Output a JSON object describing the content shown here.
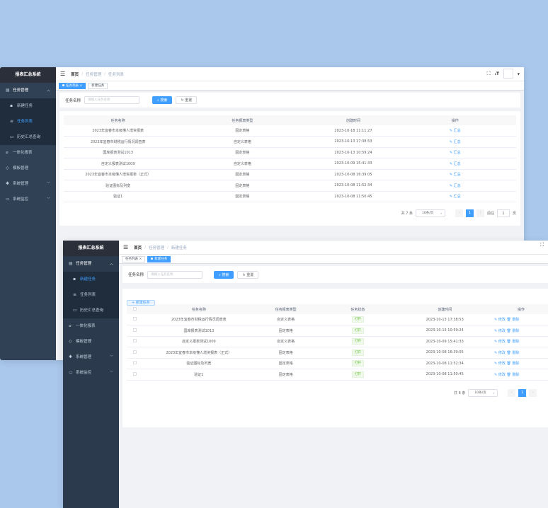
{
  "win1": {
    "app_title": "报表汇总系统",
    "menu": [
      {
        "label": "任务管理",
        "chevron": "^"
      },
      {
        "label": "新建任务"
      },
      {
        "label": "任务列表"
      },
      {
        "label": "历史汇总查询"
      },
      {
        "label": "一体化报表"
      },
      {
        "label": "模板管理"
      },
      {
        "label": "系统管理",
        "chevron": "v"
      },
      {
        "label": "系统监控",
        "chevron": "v"
      }
    ],
    "breadcrumb": [
      "首页",
      "任务管理",
      "任务列表"
    ],
    "tags": [
      {
        "label": "任务列表",
        "close": "×"
      },
      {
        "label": "新建任务"
      }
    ],
    "search": {
      "label": "任务名称",
      "placeholder": "请输入任务名称",
      "search_btn": "搜索",
      "reset_btn": "重置"
    },
    "columns": [
      "任务名称",
      "任务报表类型",
      "创建时间",
      "操作"
    ],
    "rows": [
      [
        "2023年宜春市本级懂人增资报表",
        "固定表格",
        "2023-10-18 11:11:27",
        "汇总"
      ],
      [
        "2023年宜春市财税运行情况调查表",
        "自定义表格",
        "2023-10-13 17:38:53",
        "汇总"
      ],
      [
        "国库报表测试1013",
        "固定表格",
        "2023-10-13 10:59:24",
        "汇总"
      ],
      [
        "自定义报表测试1009",
        "自定义表格",
        "2023-10-09 15:41:33",
        "汇总"
      ],
      [
        "2023年宜春市本级懂人增资报表（正式）",
        "固定表格",
        "2023-10-08 16:39:05",
        "汇总"
      ],
      [
        "验证图标及列宽",
        "固定表格",
        "2023-10-08 11:52:34",
        "汇总"
      ],
      [
        "验证1",
        "固定表格",
        "2023-10-08 11:50:45",
        "汇总"
      ]
    ],
    "pager": {
      "total": "共 7 条",
      "size": "10条/页",
      "page": "1",
      "goto": "前往",
      "goto_val": "1",
      "page_unit": "页"
    }
  },
  "win2": {
    "app_title": "报表汇总系统",
    "menu": [
      {
        "label": "任务管理",
        "chevron": "^"
      },
      {
        "label": "新建任务"
      },
      {
        "label": "任务列表"
      },
      {
        "label": "历史汇总查询"
      },
      {
        "label": "一体化报表"
      },
      {
        "label": "模板管理"
      },
      {
        "label": "系统管理",
        "chevron": "v"
      },
      {
        "label": "系统监控",
        "chevron": "v"
      }
    ],
    "breadcrumb": [
      "首页",
      "任务管理",
      "新建任务"
    ],
    "tags": [
      {
        "label": "任务列表",
        "close": "×"
      },
      {
        "label": "新建任务"
      }
    ],
    "search": {
      "label": "任务名称",
      "placeholder": "请输入任务名称",
      "search_btn": "搜索",
      "reset_btn": "重置"
    },
    "add_btn": "新建任务",
    "columns": [
      "任务名称",
      "任务报表类型",
      "任务状态",
      "创建时间",
      "操作"
    ],
    "rows": [
      [
        "2023年宜春市财税运行情况调查表",
        "自定义表格",
        "打开",
        "2023-10-13 17:38:53"
      ],
      [
        "国库报表测试1013",
        "固定表格",
        "打开",
        "2023-10-13 10:59:24"
      ],
      [
        "自定义报表测试1009",
        "自定义表格",
        "打开",
        "2023-10-09 15:41:33"
      ],
      [
        "2023年宜春市本级懂人增资报表（正式）",
        "固定表格",
        "打开",
        "2023-10-08 16:39:05"
      ],
      [
        "验证图标及列宽",
        "固定表格",
        "打开",
        "2023-10-08 11:52:34"
      ],
      [
        "验证1",
        "固定表格",
        "打开",
        "2023-10-08 11:50:45"
      ]
    ],
    "actions": {
      "edit": "修改",
      "delete": "删除"
    },
    "pager": {
      "total": "共 6 条",
      "size": "10条/页",
      "page": "1"
    }
  },
  "colors": {
    "primary": "#409eff",
    "sidebar": "#304156",
    "background": "#a9c8ec"
  }
}
